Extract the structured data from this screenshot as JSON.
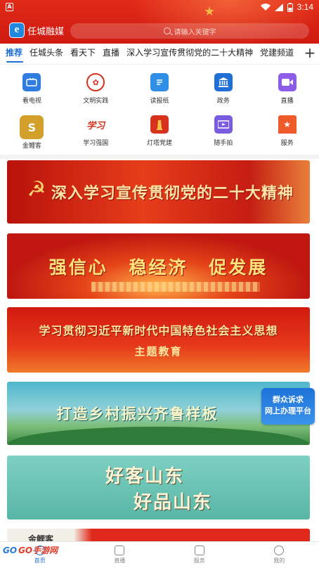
{
  "status_bar": {
    "left_badge": "A",
    "time": "3:14"
  },
  "header": {
    "logo_char": "e",
    "app_name": "任城融媒",
    "search_placeholder": "请输入关键字"
  },
  "tabs": [
    "推荐",
    "任城头条",
    "看天下",
    "直播",
    "深入学习宣传贯彻党的二十大精神",
    "党建频道"
  ],
  "grid": [
    {
      "label": "看电视",
      "icon": "tv-icon",
      "color": "#2f7de0"
    },
    {
      "label": "文明实践",
      "icon": "flower-emblem-icon",
      "color": "#d8321e"
    },
    {
      "label": "读报纸",
      "icon": "newspaper-icon",
      "color": "#2f8fe6"
    },
    {
      "label": "政务",
      "icon": "government-building-icon",
      "color": "#1f6fd6"
    },
    {
      "label": "直播",
      "icon": "video-camera-icon",
      "color": "#8c5ce6"
    },
    {
      "label": "金鲤客",
      "icon": "golden-carp-icon",
      "color": "#d4a02c"
    },
    {
      "label": "学习强国",
      "icon": "xuexi-qiangguo-icon",
      "color": "#d8321e"
    },
    {
      "label": "灯塔党建",
      "icon": "lighthouse-icon",
      "color": "#d8321e"
    },
    {
      "label": "随手拍",
      "icon": "film-camera-icon",
      "color": "#7a5ce0"
    },
    {
      "label": "服务",
      "icon": "bookmark-star-icon",
      "color": "#ef5a2a"
    }
  ],
  "banners": {
    "b1": "深入学习宣传贯彻党的二十大精神",
    "b2": "强信心 稳经济 促发展",
    "b3_line1": "学习贯彻习近平新时代中国特色社会主义思想",
    "b3_line2": "主题教育",
    "b4": "打造乡村振兴齐鲁样板",
    "b5_line1": "好客山东",
    "b5_line2": "好品山东",
    "b6": "金鲤客"
  },
  "float_badge": {
    "line1": "群众诉求",
    "line2": "网上办理平台"
  },
  "bottom_nav": [
    {
      "label": "首页",
      "icon": "home-icon",
      "active": true
    },
    {
      "label": "直播",
      "icon": "play-icon",
      "active": false
    },
    {
      "label": "服务",
      "icon": "bookmark-icon",
      "active": false
    },
    {
      "label": "我的",
      "icon": "user-icon",
      "active": false
    }
  ],
  "watermark": {
    "part1": "GO",
    "part2": "GO手游网"
  }
}
